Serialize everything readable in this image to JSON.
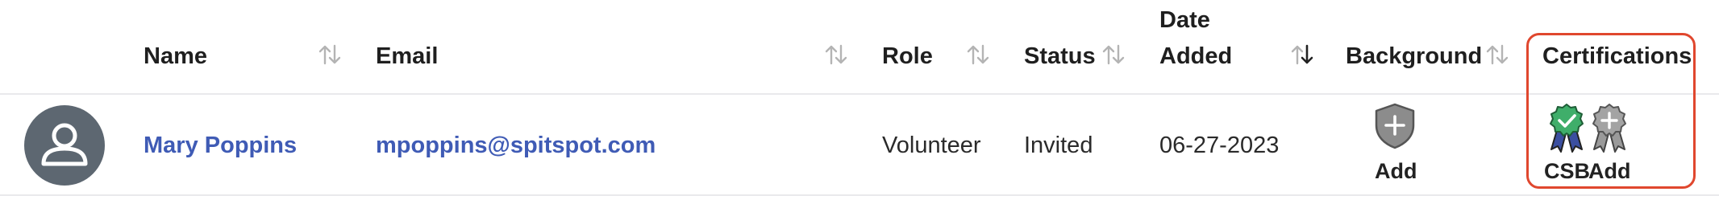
{
  "columns": {
    "name": "Name",
    "email": "Email",
    "role": "Role",
    "status": "Status",
    "date_added_line1": "Date",
    "date_added_line2": "Added",
    "background": "Background",
    "certifications": "Certifications"
  },
  "row": {
    "name": "Mary Poppins",
    "email": "mpoppins@spitspot.com",
    "role": "Volunteer",
    "status": "Invited",
    "date_added": "06-27-2023",
    "background_label": "Add",
    "certifications": [
      {
        "label": "CSB",
        "icon": "award-ribbon-check-icon",
        "color": "#3fae6a"
      },
      {
        "label": "Add",
        "icon": "award-ribbon-add-icon",
        "color": "#9a9a9a"
      }
    ]
  },
  "colors": {
    "link": "#3f5bb5",
    "highlight": "#e0472e",
    "avatar_bg": "#5d6771",
    "shield_gray": "#8c8c8c"
  }
}
